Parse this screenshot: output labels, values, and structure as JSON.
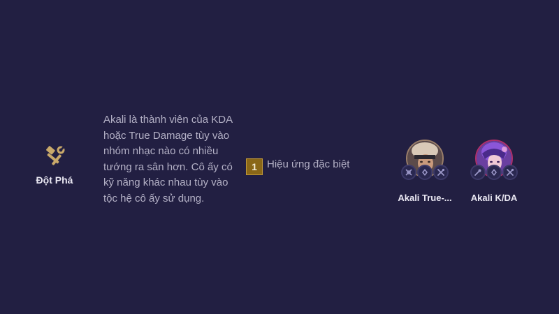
{
  "trait": {
    "icon": "breakout-trait-icon",
    "name": "Đột Phá",
    "description": "Akali là thành viên của KDA hoặc True Damage tùy vào nhóm nhạc nào có nhiều tướng ra sân hơn. Cô ấy có kỹ năng khác nhau tùy vào tộc hệ cô ấy sử dụng."
  },
  "effects": [
    {
      "tier": "1",
      "label": "Hiệu ứng đặc biệt"
    }
  ],
  "champions": [
    {
      "name": "Akali True-...",
      "trait_icons": [
        "true-damage-trait-icon",
        "executioner-trait-icon",
        "breakout-trait-icon"
      ]
    },
    {
      "name": "Akali K/DA",
      "trait_icons": [
        "kda-trait-icon",
        "executioner-trait-icon",
        "breakout-trait-icon"
      ]
    }
  ],
  "colors": {
    "background": "#221f42",
    "trait_icon": "#c9a96a",
    "tier_badge": "#8a6717",
    "portrait_border": "#b0306b"
  }
}
